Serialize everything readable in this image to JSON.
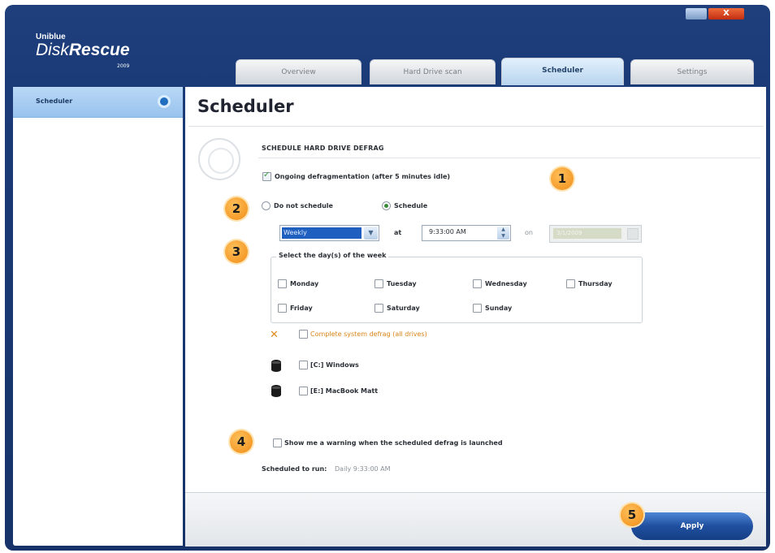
{
  "window": {
    "minimize_label": "",
    "close_label": "X"
  },
  "logo": {
    "brand": "Uniblue",
    "name_light": "Disk",
    "name_bold": "Rescue",
    "year": "2009"
  },
  "tabs": [
    {
      "label": "Overview"
    },
    {
      "label": "Hard Drive scan"
    },
    {
      "label": "Scheduler"
    },
    {
      "label": "Settings"
    }
  ],
  "sidebar": {
    "items": [
      {
        "label": "Scheduler"
      }
    ]
  },
  "page": {
    "title": "Scheduler",
    "section_title": "SCHEDULE HARD DRIVE DEFRAG",
    "ongoing_label": "Ongoing defragmentation (after 5 minutes idle)",
    "do_not_schedule_label": "Do not schedule",
    "schedule_label": "Schedule",
    "frequency_value": "Weekly",
    "at_label": "at",
    "time_value": "9:33:00 AM",
    "on_label": "on",
    "date_value": "3/1/2009",
    "days_legend": "Select the day(s) of the week",
    "days": [
      "Monday",
      "Tuesday",
      "Wednesday",
      "Thursday",
      "Friday",
      "Saturday",
      "Sunday"
    ],
    "complete_defrag_label": "Complete system defrag (all drives)",
    "drives": [
      "[C:] Windows",
      "[E:] MacBook Matt"
    ],
    "warning_label": "Show me a warning when the scheduled defrag is launched",
    "scheduled_label": "Scheduled to run:",
    "scheduled_value": "Daily 9:33:00 AM",
    "apply_label": "Apply"
  },
  "badges": [
    "1",
    "2",
    "3",
    "4",
    "5"
  ],
  "colors": {
    "window_bg": "#1b3b78",
    "accent_orange": "#f08c16",
    "apply_button": "#1f4f9f",
    "sidebar_selected": "#b9d8f6"
  }
}
